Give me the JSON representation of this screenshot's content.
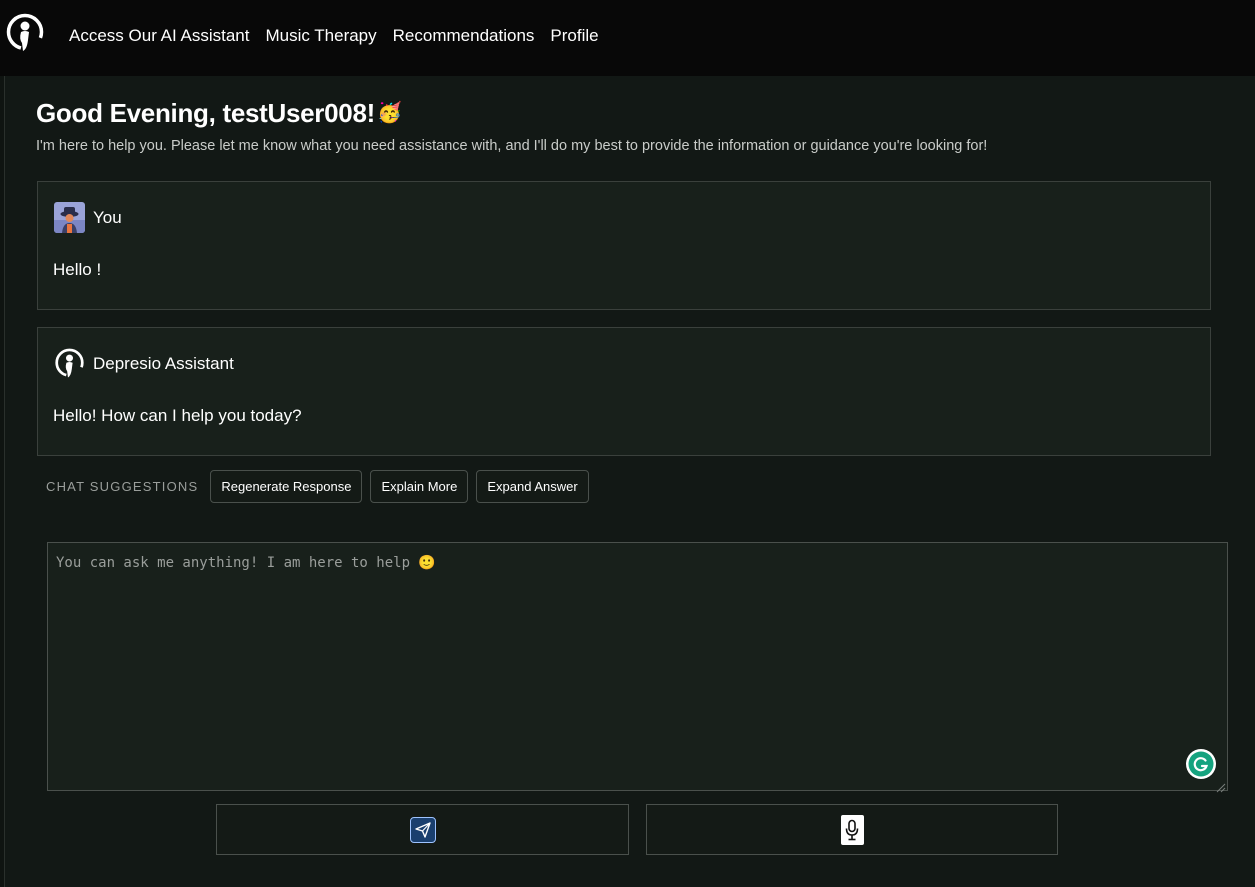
{
  "nav": {
    "items": [
      "Access Our AI Assistant",
      "Music Therapy",
      "Recommendations",
      "Profile"
    ]
  },
  "greeting": {
    "title": "Good Evening, testUser008!",
    "emoji": "🥳",
    "subtitle": "I'm here to help you. Please let me know what you need assistance with, and I'll do my best to provide the information or guidance you're looking for!"
  },
  "messages": [
    {
      "sender": "You",
      "text": "Hello !",
      "avatar_icon": "user-avatar"
    },
    {
      "sender": "Depresio Assistant",
      "text": "Hello! How can I help you today?",
      "avatar_icon": "assistant-logo-icon"
    }
  ],
  "suggestions": {
    "label": "CHAT SUGGESTIONS",
    "chips": [
      "Regenerate Response",
      "Explain More",
      "Expand Answer"
    ]
  },
  "input": {
    "placeholder": "You can ask me anything! I am here to help 🙂",
    "value": ""
  },
  "actions": {
    "send_icon": "send-icon",
    "mic_icon": "microphone-icon"
  },
  "colors": {
    "background": "#121815",
    "navbar": "#080808",
    "card": "#18201b",
    "border": "#3a403c",
    "grammarly": "#15a37f"
  }
}
